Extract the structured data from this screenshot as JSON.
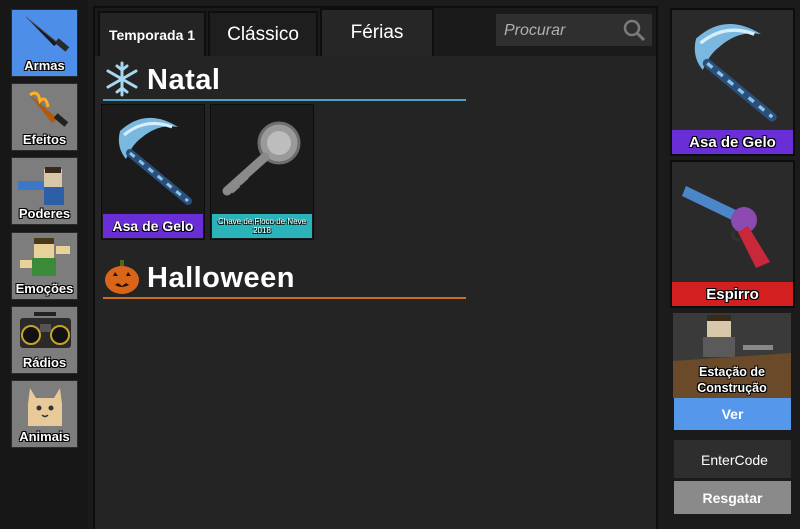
{
  "sidebar": {
    "items": [
      {
        "label": "Armas",
        "icon": "knife-icon",
        "active": true
      },
      {
        "label": "Efeitos",
        "icon": "flame-knife-icon",
        "active": false
      },
      {
        "label": "Poderes",
        "icon": "power-character-icon",
        "active": false
      },
      {
        "label": "Emoções",
        "icon": "emote-character-icon",
        "active": false
      },
      {
        "label": "Rádios",
        "icon": "boombox-icon",
        "active": false
      },
      {
        "label": "Animais",
        "icon": "cat-pet-icon",
        "active": false
      }
    ]
  },
  "tabs": [
    {
      "label": "Temporada 1"
    },
    {
      "label": "Clássico"
    },
    {
      "label": "Férias",
      "active": true
    }
  ],
  "search": {
    "placeholder": "Procurar",
    "icon": "search-icon"
  },
  "sections": [
    {
      "title": "Natal",
      "icon": "snowflake-icon",
      "rule_color": "#4aa3c4",
      "items": [
        {
          "name": "Asa de Gelo",
          "rarity_color": "#6a2ed6",
          "icon": "ice-scythe-icon"
        },
        {
          "name": "Chave de Floco de Neve 2018",
          "rarity_color": "#2ab3b8",
          "icon": "snowflake-key-icon"
        }
      ]
    },
    {
      "title": "Halloween",
      "icon": "pumpkin-icon",
      "rule_color": "#c9701f",
      "items": []
    }
  ],
  "equipped": [
    {
      "name": "Asa de Gelo",
      "color": "#6a2ed6",
      "icon": "ice-scythe-icon"
    },
    {
      "name": "Espirro",
      "color": "#d31f1f",
      "icon": "revolver-icon"
    }
  ],
  "crafting": {
    "title": "Estação de Construção",
    "button": "Ver"
  },
  "code": {
    "placeholder": "EnterCode",
    "button": "Resgatar"
  },
  "colors": {
    "active_tab": "#4d8ee9",
    "ver_button": "#5597ea",
    "resgatar_button": "#8a8a8a"
  }
}
